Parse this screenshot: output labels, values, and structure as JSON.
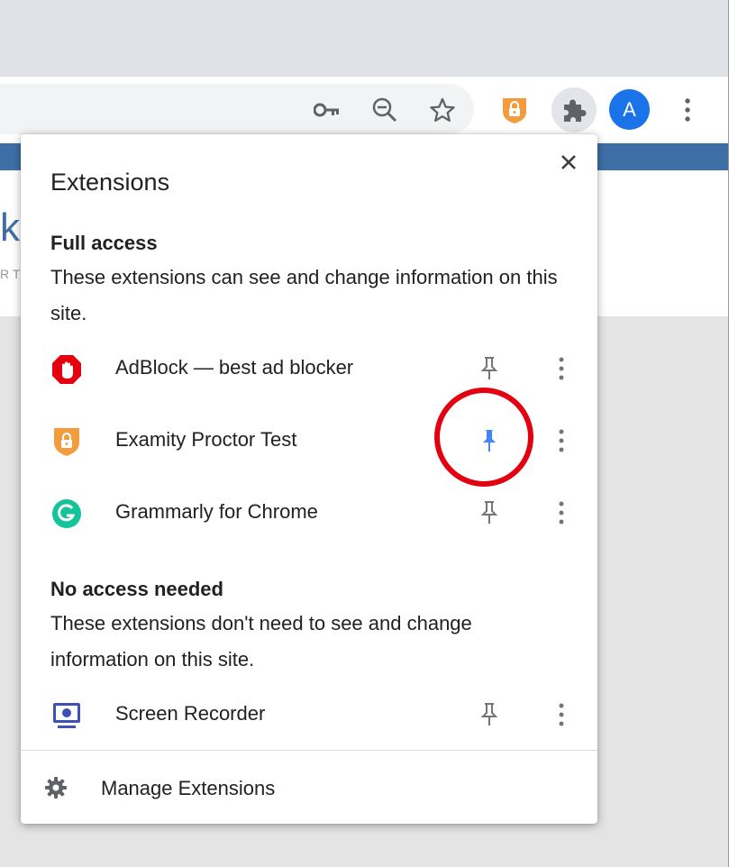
{
  "browser": {
    "avatar_initial": "A",
    "toolbar_icons": [
      "key-icon",
      "zoom-out-icon",
      "star-icon",
      "examity-extension-icon",
      "puzzle-icon",
      "avatar",
      "more-vert-icon"
    ]
  },
  "popup": {
    "title": "Extensions",
    "full_access": {
      "heading": "Full access",
      "description": "These extensions can see and change information on this site."
    },
    "no_access": {
      "heading": "No access needed",
      "description": "These extensions don't need to see and change information on this site."
    },
    "extensions": [
      {
        "name": "AdBlock — best ad blocker",
        "pinned": false,
        "icon": "adblock-icon"
      },
      {
        "name": "Examity Proctor Test",
        "pinned": true,
        "icon": "examity-icon"
      },
      {
        "name": "Grammarly for Chrome",
        "pinned": false,
        "icon": "grammarly-icon"
      },
      {
        "name": "Screen Recorder",
        "pinned": false,
        "icon": "screen-recorder-icon"
      }
    ],
    "manage_label": "Manage Extensions"
  },
  "colors": {
    "pin_active": "#4285f4",
    "pin_inactive": "#757575",
    "highlight": "#e3000f",
    "page_banner": "#3d6fa6"
  }
}
